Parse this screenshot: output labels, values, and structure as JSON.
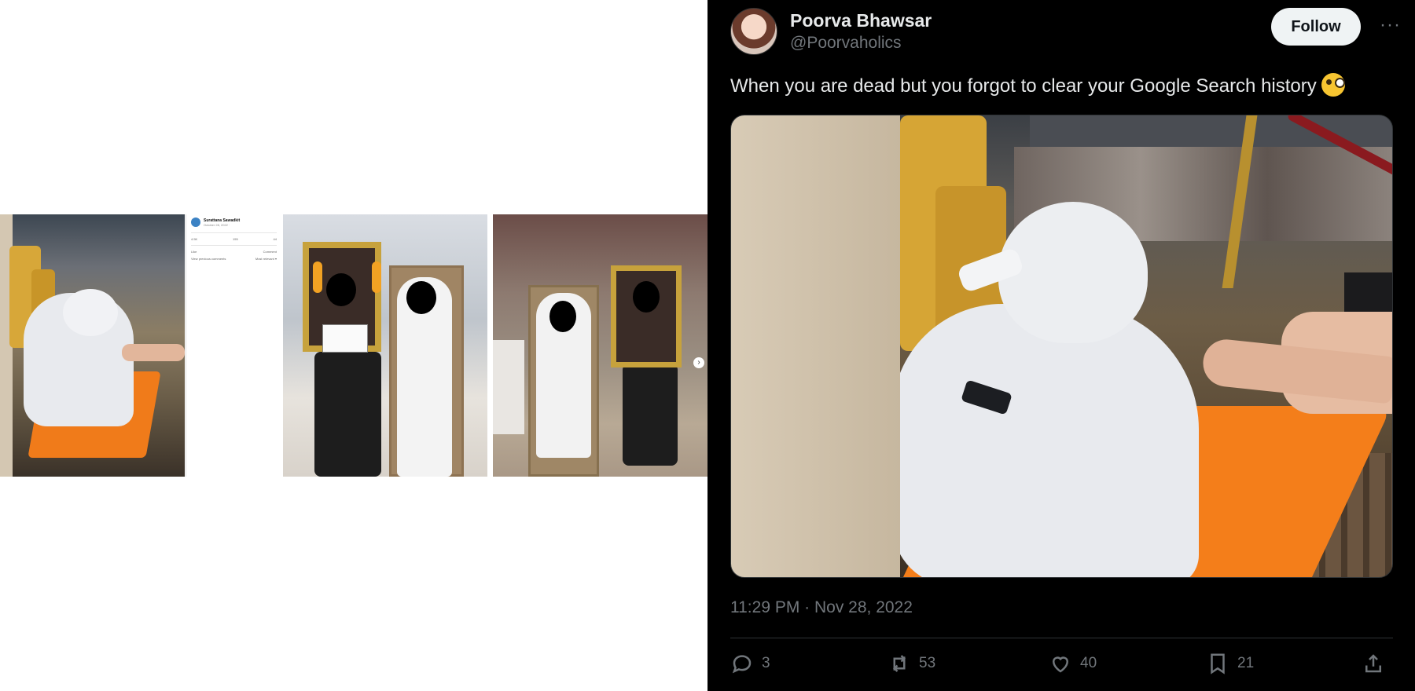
{
  "left_collage": {
    "fb_post": {
      "name": "Surattana Sawadkit",
      "date": "October 28, 2022 · ",
      "reactions": "4.5K",
      "comments_count": "155",
      "shares_count": "44",
      "like_label": "Like",
      "comment_label": "Comment",
      "view_previous": "View previous comments",
      "most_relevant": "Most relevant ▾"
    }
  },
  "tweet": {
    "user": {
      "display_name": "Poorva Bhawsar",
      "handle": "@Poorvaholics"
    },
    "follow_label": "Follow",
    "more_label": "···",
    "text": "When you are dead but you forgot to clear your Google Search history",
    "timestamp": "11:29 PM · Nov 28, 2022",
    "actions": {
      "replies": "3",
      "reposts": "53",
      "likes": "40",
      "bookmarks": "21"
    },
    "colors": {
      "background": "#000000",
      "text": "#e7e9ea",
      "muted": "#71767b",
      "follow_bg": "#eff3f4"
    }
  }
}
